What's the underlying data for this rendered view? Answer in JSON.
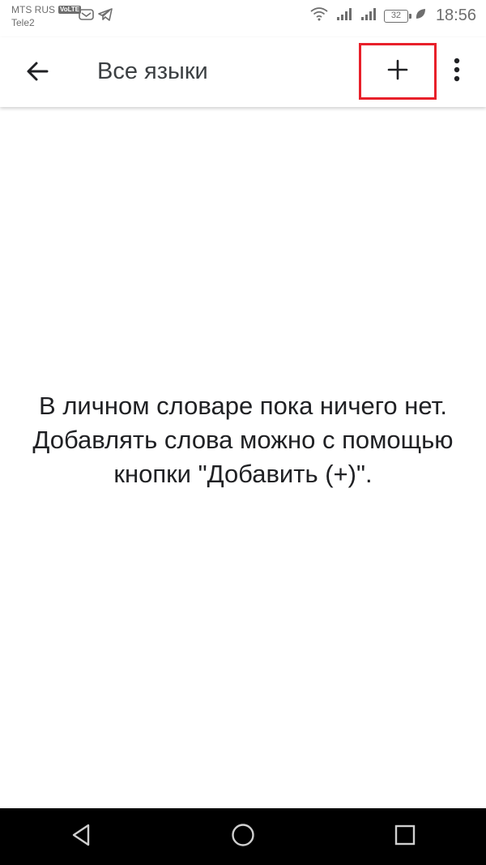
{
  "status_bar": {
    "carrier_1": "MTS RUS",
    "volte_badge": "VoLTE",
    "carrier_2": "Tele2",
    "battery": "32",
    "time": "18:56"
  },
  "app_bar": {
    "title": "Все языки",
    "back_icon": "arrow-back-icon",
    "add_icon": "plus-icon",
    "more_icon": "more-vertical-icon",
    "highlight_color": "#e8202a"
  },
  "empty_state": {
    "message": "В личном словаре пока ничего нет. Добавлять слова можно с помощью кнопки \"Добавить (+)\"."
  },
  "nav_bar": {
    "back_icon": "nav-back-triangle-icon",
    "home_icon": "nav-home-circle-icon",
    "recents_icon": "nav-recents-square-icon"
  }
}
